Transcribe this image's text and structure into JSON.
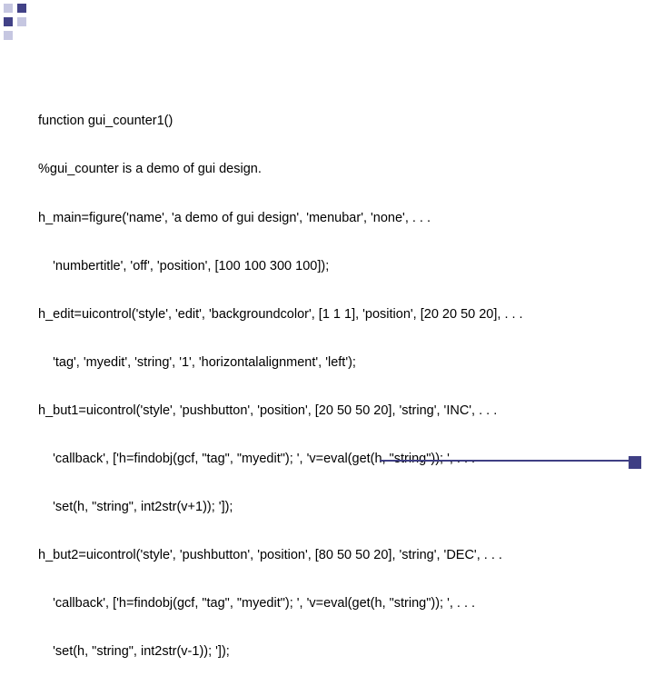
{
  "code": {
    "lines": [
      "function gui_counter1()",
      "%gui_counter is a demo of gui design.",
      "h_main=figure('name', 'a demo of gui design', 'menubar', 'none', . . .",
      "    'numbertitle', 'off', 'position', [100 100 300 100]);",
      "h_edit=uicontrol('style', 'edit', 'backgroundcolor', [1 1 1], 'position', [20 20 50 20], . . .",
      "    'tag', 'myedit', 'string', '1', 'horizontalalignment', 'left');",
      "h_but1=uicontrol('style', 'pushbutton', 'position', [20 50 50 20], 'string', 'INC', . . .",
      "    'callback', ['h=findobj(gcf, \"tag\", \"myedit\"); ', 'v=eval(get(h, \"string\")); ', . . .",
      "    'set(h, \"string\", int2str(v+1)); ']);",
      "h_but2=uicontrol('style', 'pushbutton', 'position', [80 50 50 20], 'string', 'DEC', . . .",
      "    'callback', ['h=findobj(gcf, \"tag\", \"myedit\"); ', 'v=eval(get(h, \"string\")); ', . . .",
      "    'set(h, \"string\", int2str(v-1)); ']);"
    ]
  }
}
